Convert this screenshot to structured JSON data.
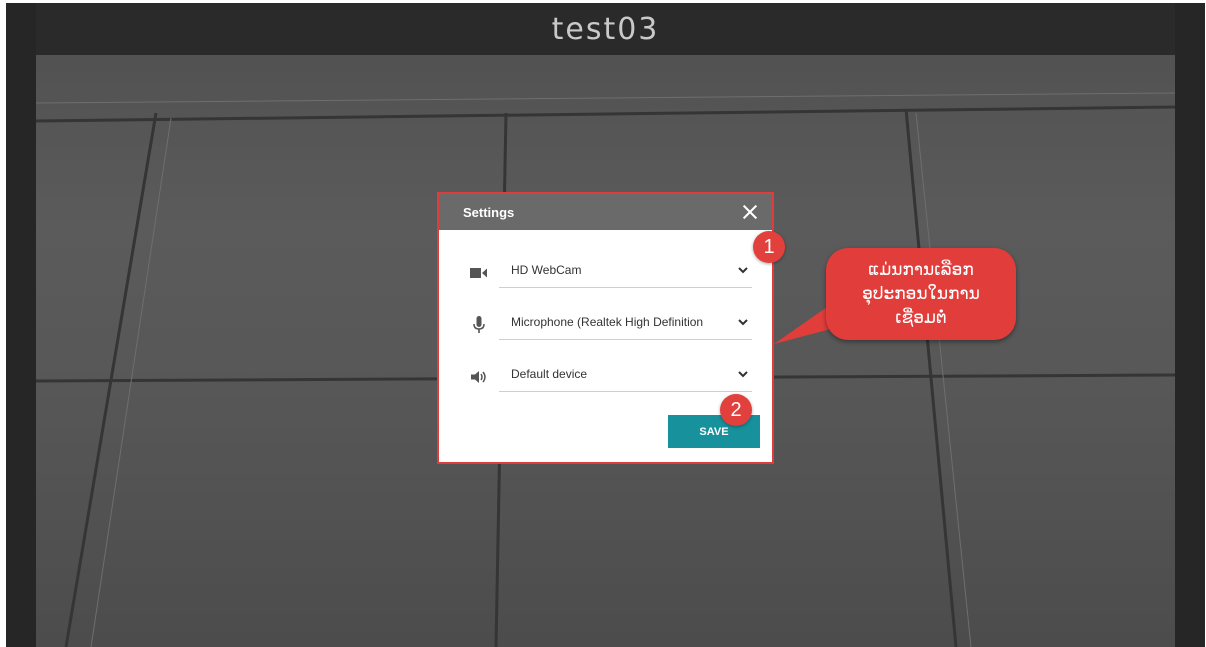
{
  "video": {
    "participant_name": "test03"
  },
  "settings_dialog": {
    "title": "Settings",
    "close_icon": "close-icon",
    "camera": {
      "icon": "camera-icon",
      "value": "HD WebCam"
    },
    "microphone": {
      "icon": "microphone-icon",
      "value": "Microphone (Realtek High Definition"
    },
    "speaker": {
      "icon": "speaker-icon",
      "value": "Default device"
    },
    "save_label": "SAVE",
    "accent_color": "#17919b"
  },
  "annotations": {
    "badge_1": "1",
    "badge_2": "2",
    "callout_text": "ແມ່ນການເລືອກອຸປະກອນໃນການເຊື່ອມຕໍ່",
    "color": "#e13d3b"
  }
}
